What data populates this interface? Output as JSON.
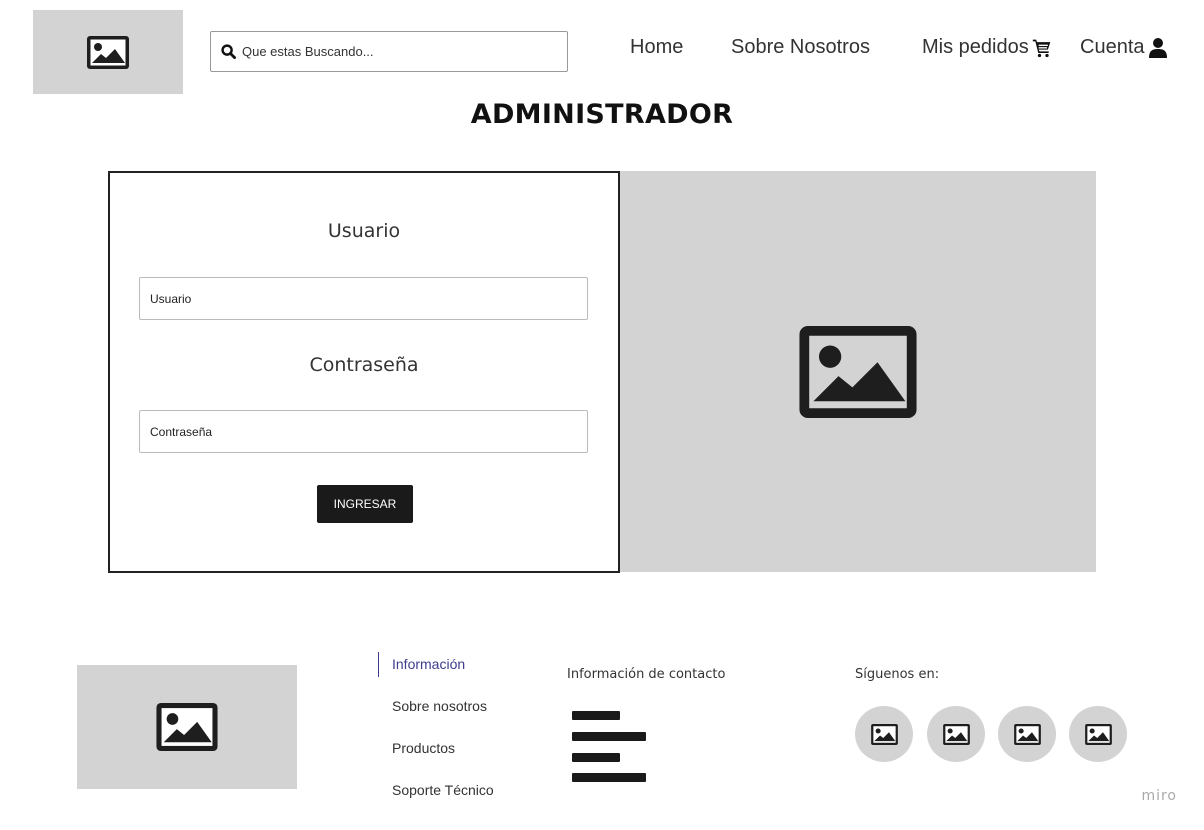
{
  "header": {
    "search": {
      "placeholder": "Que estas Buscando..."
    },
    "nav": {
      "home": "Home",
      "about": "Sobre Nosotros",
      "orders": "Mis pedidos",
      "account": "Cuenta"
    }
  },
  "page": {
    "title": "ADMINISTRADOR"
  },
  "login": {
    "user_label": "Usuario",
    "user_placeholder": "Usuario",
    "password_label": "Contraseña",
    "password_placeholder": "Contraseña",
    "submit_label": "INGRESAR"
  },
  "footer": {
    "nav": [
      "Información",
      "Sobre nosotros",
      "Productos",
      "Soporte Técnico"
    ],
    "contact_heading": "Información de contacto",
    "social_heading": "Síguenos en:"
  },
  "watermark": "miro",
  "icons": {
    "image": "image-placeholder-icon",
    "search": "search-icon",
    "cart": "cart-icon",
    "user": "user-icon",
    "text_lines": "text-lines-icon"
  },
  "colors": {
    "placeholder_bg": "#d3d3d3",
    "button_bg": "#1a1a1a",
    "active_link": "#3d3d8f"
  }
}
